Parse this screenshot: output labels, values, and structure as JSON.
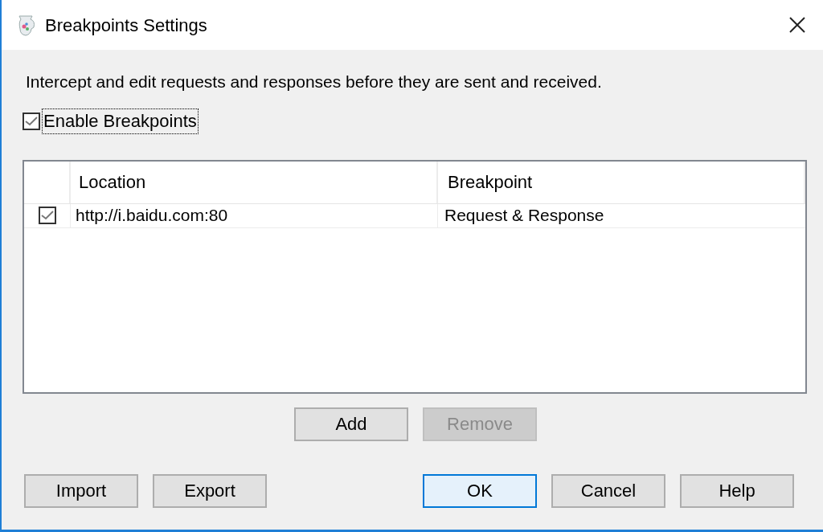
{
  "window": {
    "title": "Breakpoints Settings"
  },
  "description": "Intercept and edit requests and responses before they are sent and received.",
  "enable_checkbox": {
    "label": "Enable Breakpoints",
    "checked": true
  },
  "table": {
    "columns": [
      "Location",
      "Breakpoint"
    ],
    "rows": [
      {
        "checked": true,
        "location": "http://i.baidu.com:80",
        "breakpoint": "Request & Response"
      }
    ]
  },
  "list_buttons": [
    {
      "label": "Add",
      "disabled": false
    },
    {
      "label": "Remove",
      "disabled": true
    }
  ],
  "footer_left": [
    {
      "label": "Import",
      "default": false
    },
    {
      "label": "Export",
      "default": false
    }
  ],
  "footer_right": [
    {
      "label": "OK",
      "default": true
    },
    {
      "label": "Cancel",
      "default": false
    },
    {
      "label": "Help",
      "default": false
    }
  ]
}
